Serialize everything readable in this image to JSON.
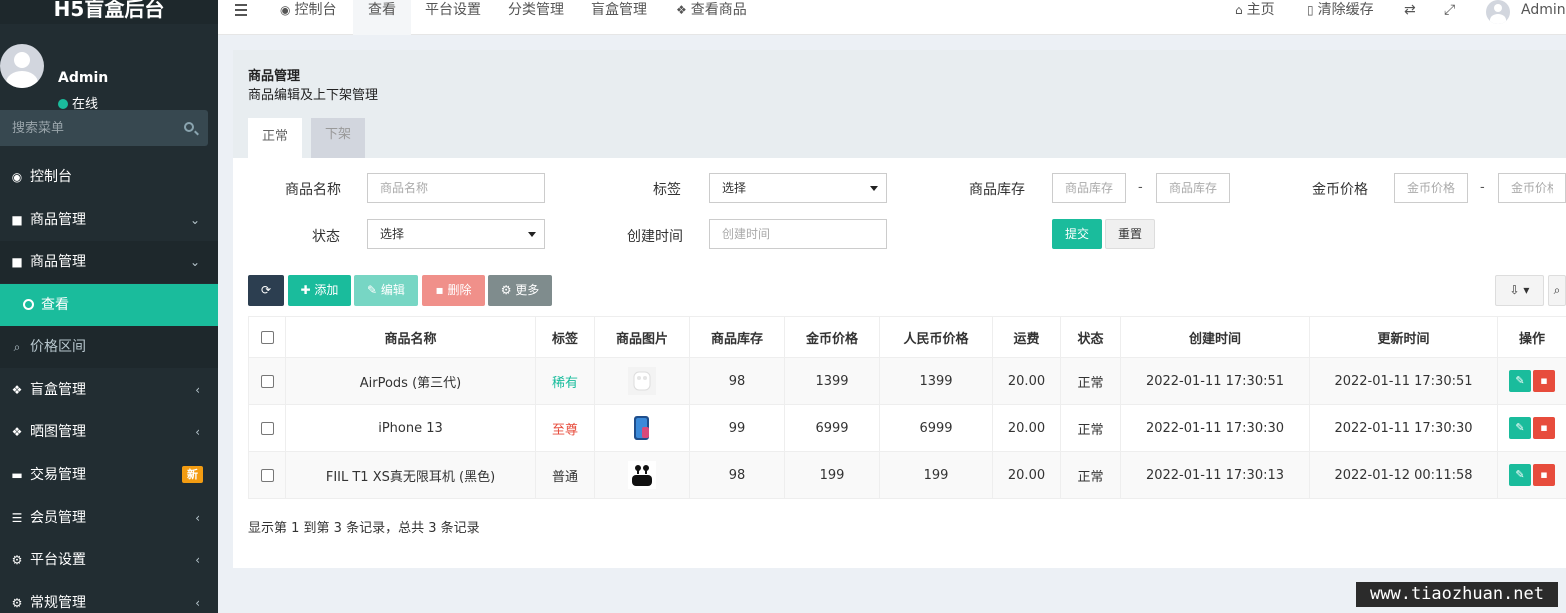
{
  "app": {
    "title": "H5盲盒后台"
  },
  "user": {
    "name": "Admin",
    "status": "在线"
  },
  "sidebar": {
    "search_placeholder": "搜索菜单",
    "items": [
      {
        "label": "控制台",
        "icon": "dashboard-icon"
      },
      {
        "label": "商品管理",
        "icon": "shopping-bag-icon"
      },
      {
        "label": "商品管理",
        "icon": "shopping-bag-icon"
      },
      {
        "label": "查看",
        "icon": "circle-icon"
      },
      {
        "label": "价格区间",
        "icon": "search-icon"
      },
      {
        "label": "盲盒管理",
        "icon": "dropbox-icon"
      },
      {
        "label": "晒图管理",
        "icon": "dropbox-icon"
      },
      {
        "label": "交易管理",
        "icon": "cart-icon",
        "badge": "新"
      },
      {
        "label": "会员管理",
        "icon": "list-icon"
      },
      {
        "label": "平台设置",
        "icon": "cogs-icon"
      },
      {
        "label": "常规管理",
        "icon": "cogs-icon"
      }
    ]
  },
  "topbar": {
    "tabs": [
      {
        "label": "控制台",
        "icon": "dashboard-icon"
      },
      {
        "label": "查看"
      },
      {
        "label": "平台设置"
      },
      {
        "label": "分类管理"
      },
      {
        "label": "盲盒管理"
      },
      {
        "label": "查看商品",
        "icon": "dropbox-icon"
      }
    ],
    "home": "主页",
    "clear_cache": "清除缓存",
    "user": "Admin"
  },
  "panel": {
    "title": "商品管理",
    "subtitle": "商品编辑及上下架管理",
    "tabs": [
      "正常",
      "下架"
    ]
  },
  "filters": {
    "name_label": "商品名称",
    "name_placeholder": "商品名称",
    "tag_label": "标签",
    "tag_value": "选择",
    "stock_label": "商品库存",
    "stock_min_placeholder": "商品库存",
    "stock_max_placeholder": "商品库存",
    "price_label": "金币价格",
    "price_min_placeholder": "金币价格",
    "price_max_placeholder": "金币价格",
    "range_sep": "-",
    "status_label": "状态",
    "status_value": "选择",
    "created_label": "创建时间",
    "created_placeholder": "创建时间",
    "submit": "提交",
    "reset": "重置"
  },
  "toolbar": {
    "add": "添加",
    "edit": "编辑",
    "delete": "删除",
    "more": "更多"
  },
  "table": {
    "headers": [
      "商品名称",
      "标签",
      "商品图片",
      "商品库存",
      "金币价格",
      "人民币价格",
      "运费",
      "状态",
      "创建时间",
      "更新时间",
      "操作"
    ],
    "rows": [
      {
        "name": "AirPods (第三代)",
        "tag": "稀有",
        "tag_color": "#18bc9c",
        "image": "airpods-image",
        "stock": "98",
        "coin_price": "1399",
        "rmb_price": "1399",
        "shipping": "20.00",
        "status": "正常",
        "created": "2022-01-11 17:30:51",
        "updated": "2022-01-11 17:30:51"
      },
      {
        "name": "iPhone 13",
        "tag": "至尊",
        "tag_color": "#e74c3c",
        "image": "iphone-image",
        "stock": "99",
        "coin_price": "6999",
        "rmb_price": "6999",
        "shipping": "20.00",
        "status": "正常",
        "created": "2022-01-11 17:30:30",
        "updated": "2022-01-11 17:30:30"
      },
      {
        "name": "FIIL T1 XS真无限耳机 (黑色)",
        "tag": "普通",
        "tag_color": "#333333",
        "image": "earbuds-image",
        "stock": "98",
        "coin_price": "199",
        "rmb_price": "199",
        "shipping": "20.00",
        "status": "正常",
        "created": "2022-01-11 17:30:13",
        "updated": "2022-01-12 00:11:58"
      }
    ],
    "summary": "显示第 1 到第 3 条记录，总共 3 条记录"
  },
  "watermark": "www.tiaozhuan.net",
  "colors": {
    "sidebar_bg": "#222d32",
    "accent": "#1abc9c",
    "danger": "#e74c3c",
    "warning": "#f39c12"
  }
}
